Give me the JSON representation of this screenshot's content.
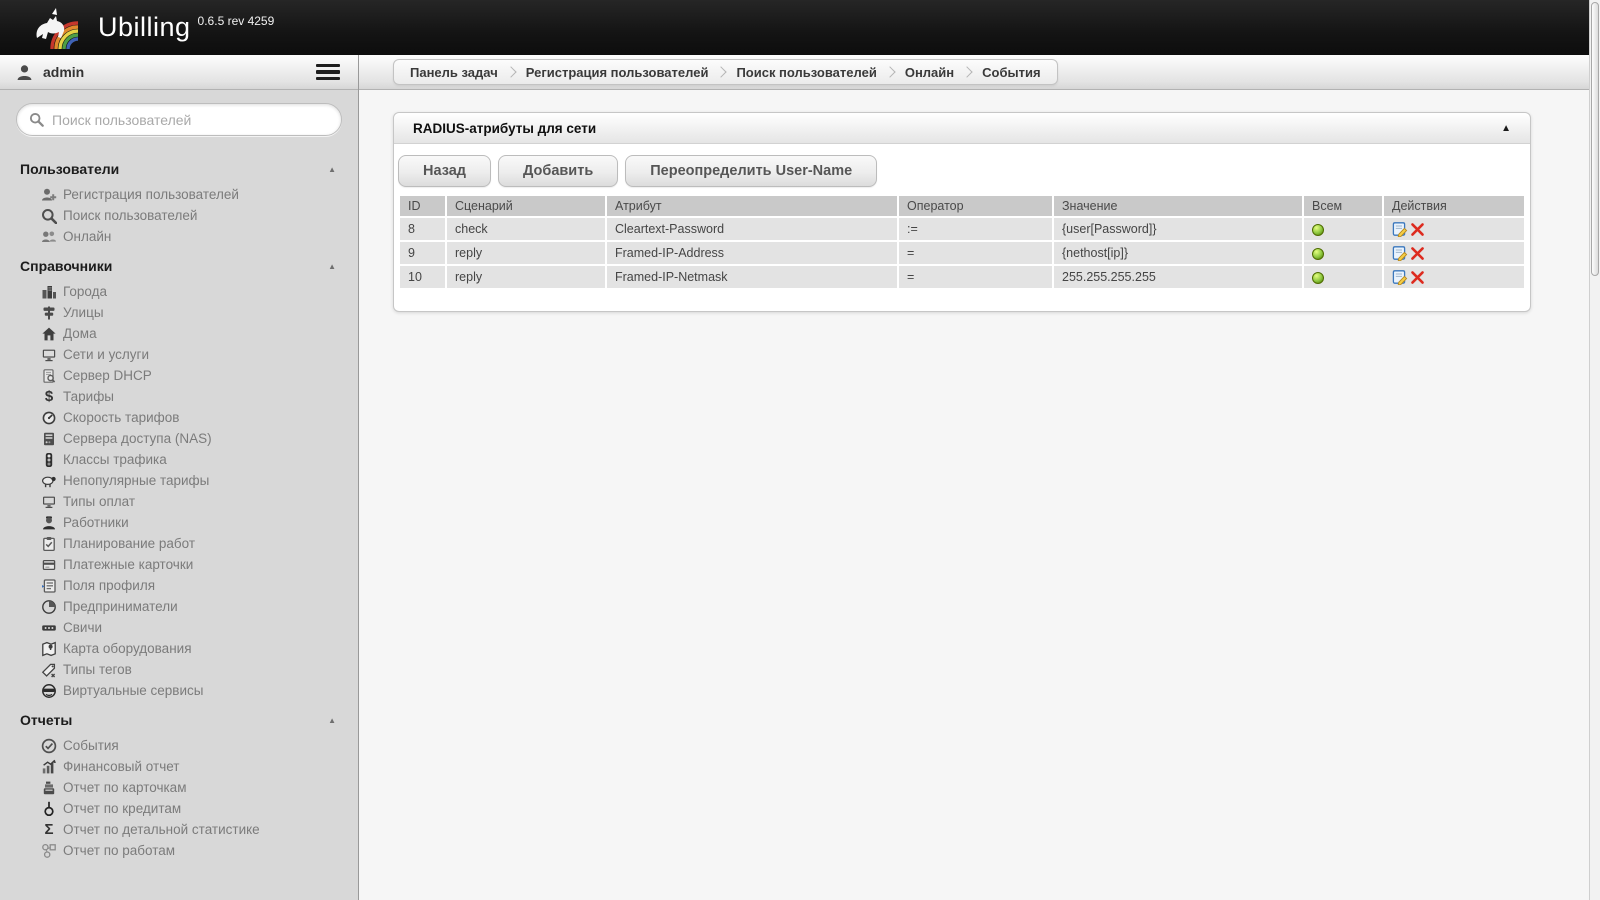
{
  "app": {
    "brand": "Ubilling",
    "version": "0.6.5 rev 4259"
  },
  "sidebar": {
    "user": "admin",
    "search_placeholder": "Поиск пользователей",
    "sections": [
      {
        "title": "Пользователи",
        "collapse_arrow": "▲",
        "items": [
          {
            "label": "Регистрация пользователей",
            "icon": "user-add"
          },
          {
            "label": "Поиск пользователей",
            "icon": "user-search"
          },
          {
            "label": "Онлайн",
            "icon": "users-online"
          }
        ]
      },
      {
        "title": "Справочники",
        "collapse_arrow": "▲",
        "items": [
          {
            "label": "Города",
            "icon": "city"
          },
          {
            "label": "Улицы",
            "icon": "street"
          },
          {
            "label": "Дома",
            "icon": "house"
          },
          {
            "label": "Сети и услуги",
            "icon": "network"
          },
          {
            "label": "Сервер DHCP",
            "icon": "dhcp-server"
          },
          {
            "label": "Тарифы",
            "icon": "dollar"
          },
          {
            "label": "Скорость тарифов",
            "icon": "speedometer"
          },
          {
            "label": "Сервера доступа (NAS)",
            "icon": "nas-server"
          },
          {
            "label": "Классы трафика",
            "icon": "traffic-light"
          },
          {
            "label": "Непопулярные тарифы",
            "icon": "sheep"
          },
          {
            "label": "Типы оплат",
            "icon": "payment-terminal"
          },
          {
            "label": "Работники",
            "icon": "worker"
          },
          {
            "label": "Планирование работ",
            "icon": "clipboard"
          },
          {
            "label": "Платежные карточки",
            "icon": "payment-card"
          },
          {
            "label": "Поля профиля",
            "icon": "profile-fields"
          },
          {
            "label": "Предприниматели",
            "icon": "pie-chart"
          },
          {
            "label": "Свичи",
            "icon": "switch"
          },
          {
            "label": "Карта оборудования",
            "icon": "equipment-map"
          },
          {
            "label": "Типы тегов",
            "icon": "tag"
          },
          {
            "label": "Виртуальные сервисы",
            "icon": "mask"
          }
        ]
      },
      {
        "title": "Отчеты",
        "collapse_arrow": "▲",
        "items": [
          {
            "label": "События",
            "icon": "event-check"
          },
          {
            "label": "Финансовый отчет",
            "icon": "finance-chart"
          },
          {
            "label": "Отчет по карточкам",
            "icon": "cash-register"
          },
          {
            "label": "Отчет по кредитам",
            "icon": "credit-noose"
          },
          {
            "label": "Отчет по детальной статистике",
            "icon": "sigma"
          },
          {
            "label": "Отчет по работам",
            "icon": "work-nodes"
          }
        ]
      }
    ]
  },
  "breadcrumbs": [
    "Панель задач",
    "Регистрация пользователей",
    "Поиск пользователей",
    "Онлайн",
    "События"
  ],
  "panel": {
    "title": "RADIUS-атрибуты для сети",
    "collapse_arrow": "▲",
    "buttons": [
      "Назад",
      "Добавить",
      "Переопределить User-Name"
    ],
    "table": {
      "headers": [
        "ID",
        "Сценарий",
        "Атрибут",
        "Оператор",
        "Значение",
        "Всем",
        "Действия"
      ],
      "rows": [
        {
          "id": "8",
          "scenario": "check",
          "attribute": "Cleartext-Password",
          "operator": ":=",
          "value": "{user[Password]}",
          "all_status": "enabled"
        },
        {
          "id": "9",
          "scenario": "reply",
          "attribute": "Framed-IP-Address",
          "operator": "=",
          "value": "{nethost[ip]}",
          "all_status": "enabled"
        },
        {
          "id": "10",
          "scenario": "reply",
          "attribute": "Framed-IP-Netmask",
          "operator": "=",
          "value": "255.255.255.255",
          "all_status": "enabled"
        }
      ]
    }
  },
  "colors": {
    "status_green": "#8cc63f",
    "delete_red": "#dd2b1f",
    "edit_blue": "#3b78bd",
    "topbar_black": "#141414"
  }
}
